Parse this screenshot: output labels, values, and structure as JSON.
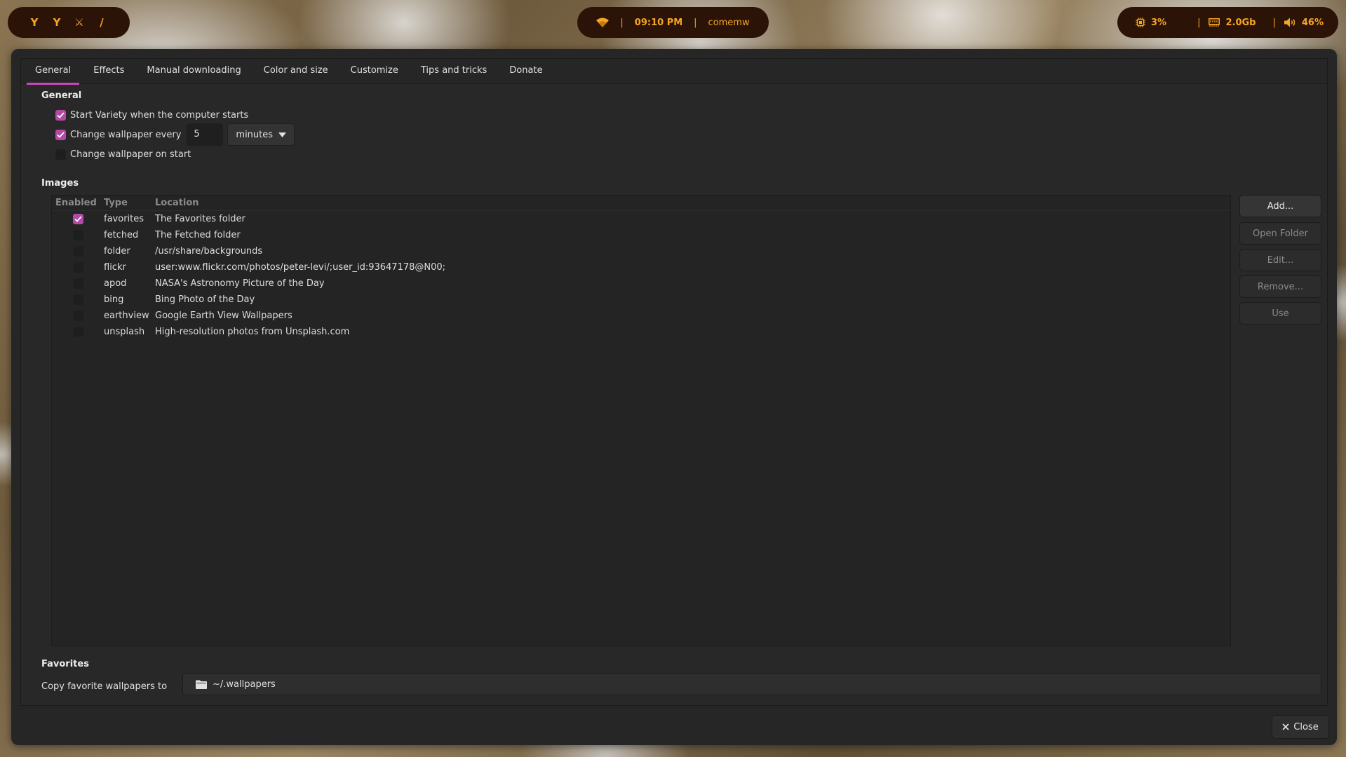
{
  "topbar": {
    "workspaces": [
      "Y",
      "Y",
      "⚔",
      "/"
    ],
    "clock": "09:10 PM",
    "network_name": "comemw",
    "cpu": "3%",
    "memory": "2.0Gb",
    "volume": "46%",
    "accent_color": "#f5a623"
  },
  "tabs": [
    {
      "label": "General"
    },
    {
      "label": "Effects"
    },
    {
      "label": "Manual downloading"
    },
    {
      "label": "Color and size"
    },
    {
      "label": "Customize"
    },
    {
      "label": "Tips and tricks"
    },
    {
      "label": "Donate"
    }
  ],
  "general": {
    "title": "General",
    "start_on_boot": {
      "label": "Start Variety when the computer starts",
      "checked": true
    },
    "change_every": {
      "label": "Change wallpaper every",
      "checked": true,
      "value": "5",
      "unit": "minutes"
    },
    "change_on_start": {
      "label": "Change wallpaper on start",
      "checked": false
    }
  },
  "images": {
    "title": "Images",
    "columns": [
      "Enabled",
      "Type",
      "Location"
    ],
    "rows": [
      {
        "enabled": true,
        "type": "favorites",
        "location": "The Favorites folder"
      },
      {
        "enabled": false,
        "type": "fetched",
        "location": "The Fetched folder"
      },
      {
        "enabled": false,
        "type": "folder",
        "location": "/usr/share/backgrounds"
      },
      {
        "enabled": false,
        "type": "flickr",
        "location": "user:www.flickr.com/photos/peter-levi/;user_id:93647178@N00;"
      },
      {
        "enabled": false,
        "type": "apod",
        "location": "NASA's Astronomy Picture of the Day"
      },
      {
        "enabled": false,
        "type": "bing",
        "location": "Bing Photo of the Day"
      },
      {
        "enabled": false,
        "type": "earthview",
        "location": "Google Earth View Wallpapers"
      },
      {
        "enabled": false,
        "type": "unsplash",
        "location": "High-resolution photos from Unsplash.com"
      }
    ],
    "buttons": {
      "add": "Add...",
      "open_folder": "Open Folder",
      "edit": "Edit...",
      "remove": "Remove...",
      "use": "Use"
    }
  },
  "favorites": {
    "title": "Favorites",
    "copy_label": "Copy favorite wallpapers to",
    "path": "~/.wallpapers"
  },
  "close_label": "Close",
  "accent_color": "#c54ab7"
}
